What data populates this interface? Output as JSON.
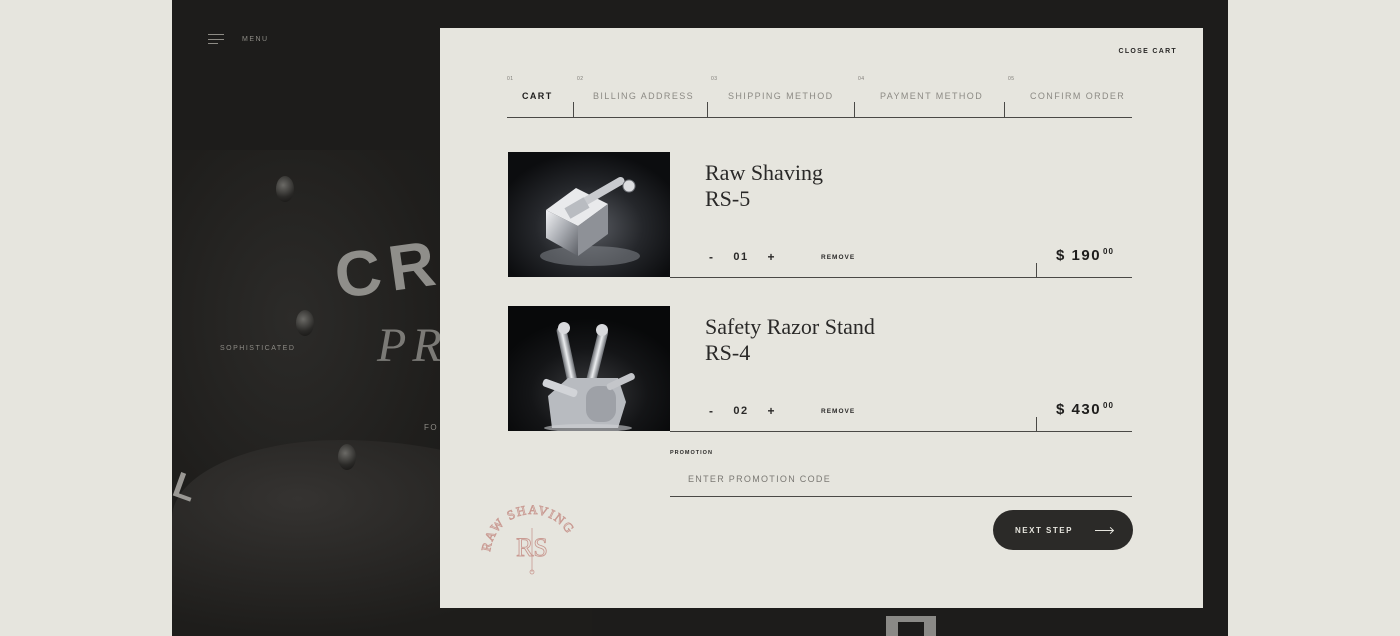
{
  "site": {
    "menu_label": "MENU",
    "tagline": "SOPHISTICATED",
    "hero_line1": "CR",
    "hero_line2": "PR",
    "hero_line3": "FO",
    "hero_fragment": "L"
  },
  "cart": {
    "close_label": "CLOSE CART",
    "steps": [
      {
        "num": "01",
        "label": "CART",
        "active": true
      },
      {
        "num": "02",
        "label": "BILLING ADDRESS",
        "active": false
      },
      {
        "num": "03",
        "label": "SHIPPING METHOD",
        "active": false
      },
      {
        "num": "04",
        "label": "PAYMENT METHOD",
        "active": false
      },
      {
        "num": "05",
        "label": "CONFIRM ORDER",
        "active": false
      }
    ],
    "items": [
      {
        "name_line1": "Raw Shaving",
        "name_line2": "RS-5",
        "qty": "01",
        "minus": "-",
        "plus": "+",
        "remove": "REMOVE",
        "price_main": "$ 190",
        "price_cents": "00"
      },
      {
        "name_line1": "Safety Razor Stand",
        "name_line2": "RS-4",
        "qty": "02",
        "minus": "-",
        "plus": "+",
        "remove": "REMOVE",
        "price_main": "$ 430",
        "price_cents": "00"
      }
    ],
    "promo": {
      "label": "PROMOTION",
      "placeholder": "ENTER PROMOTION CODE"
    },
    "next_label": "NEXT STEP",
    "logo_text": "RAW SHAVING",
    "logo_monogram": "RS"
  },
  "colors": {
    "panel_bg": "#e6e5de",
    "site_bg": "#1d1c1b",
    "button_bg": "#2b2a28",
    "logo": "#c99a92"
  }
}
